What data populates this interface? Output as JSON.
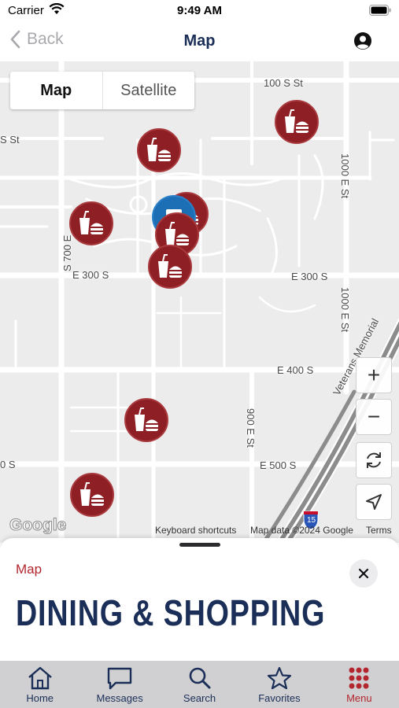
{
  "status_bar": {
    "carrier": "Carrier",
    "time": "9:49 AM"
  },
  "nav": {
    "back_label": "Back",
    "title": "Map"
  },
  "map": {
    "type_toggle": {
      "map": "Map",
      "satellite": "Satellite"
    },
    "streets": {
      "s100": "100 S St",
      "s_cut": "S St",
      "e1000a": "1000 E St",
      "s700": "S 700 E",
      "e300_left": "E 300 S",
      "e300_right": "E 300 S",
      "e1000b": "1000 E St",
      "e400": "E 400 S",
      "e900": "900 E St",
      "e500": "E 500 S",
      "o_s": "0 S",
      "veterans": "Veterans Memorial",
      "i15": "15"
    },
    "attribution": {
      "keyboard": "Keyboard shortcuts",
      "data": "Map data ©2024 Google",
      "terms": "Terms"
    },
    "logo": "Google",
    "controls": {
      "zoom_in": "+",
      "zoom_out": "−"
    }
  },
  "sheet": {
    "label": "Map",
    "heading": "DINING & SHOPPING"
  },
  "tabs": [
    {
      "label": "Home",
      "icon": "home-icon"
    },
    {
      "label": "Messages",
      "icon": "messages-icon"
    },
    {
      "label": "Search",
      "icon": "search-icon"
    },
    {
      "label": "Favorites",
      "icon": "star-icon"
    },
    {
      "label": "Menu",
      "icon": "grid-menu-icon"
    }
  ],
  "colors": {
    "navy": "#1a2e57",
    "accent_red": "#b3262e",
    "marker_red": "#8e2025",
    "marker_blue": "#1d6fb5"
  }
}
